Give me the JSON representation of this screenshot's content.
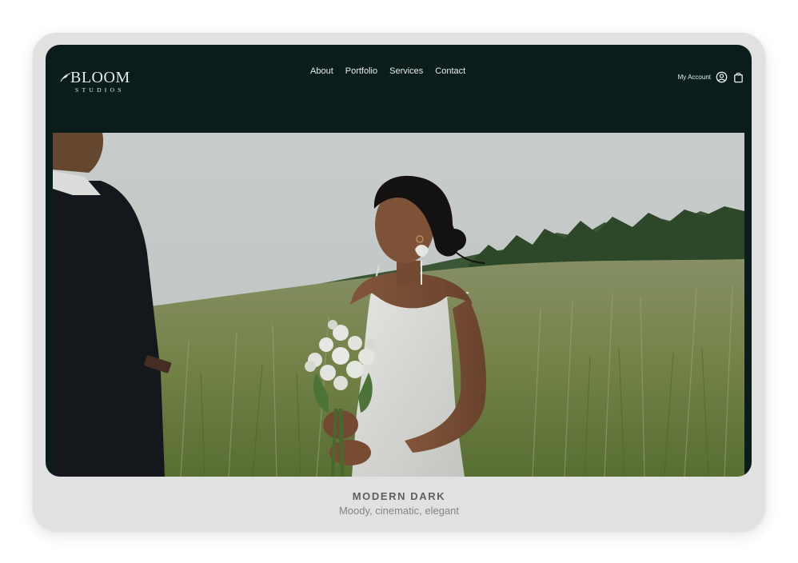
{
  "logo": {
    "wordmark": "BLOOM",
    "subtitle": "STUDIOS"
  },
  "nav": {
    "items": [
      "About",
      "Portfolio",
      "Services",
      "Contact"
    ]
  },
  "account": {
    "label": "My Account",
    "user_icon": "user-circle-icon",
    "cart_icon": "shopping-bag-icon"
  },
  "hero": {
    "image": "bride-holding-bouquet-in-meadow"
  },
  "caption": {
    "title": "MODERN DARK",
    "subtitle": "Moody, cinematic, elegant"
  },
  "colors": {
    "header_bg": "#0b1c1c",
    "header_text": "#e9eeeb",
    "card_bg": "#e1e1e1",
    "caption_title": "#5f5f5f",
    "caption_sub": "#848484"
  }
}
